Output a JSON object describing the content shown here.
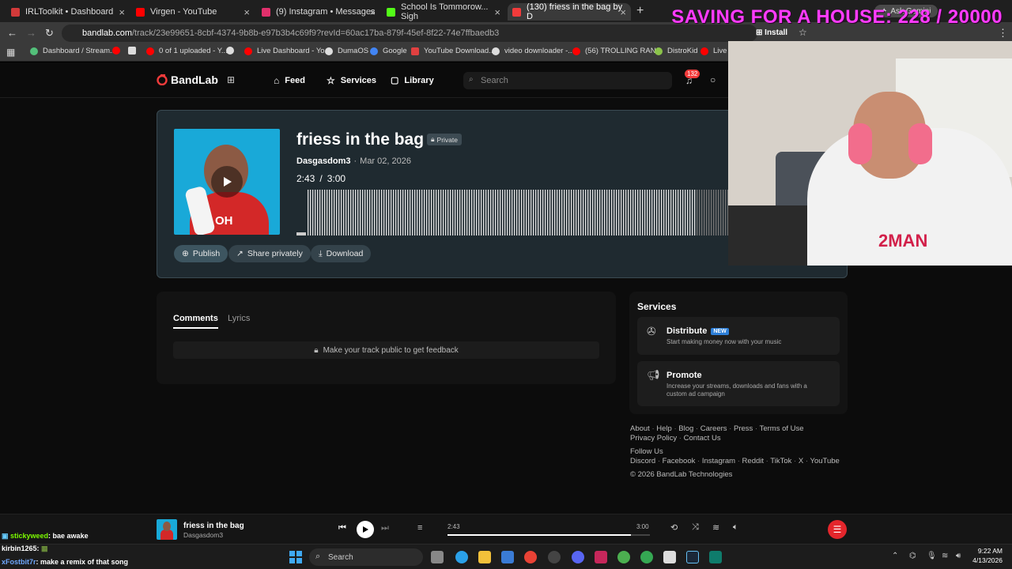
{
  "browser": {
    "tabs": [
      {
        "title": "IRLToolkit • Dashboard",
        "color": "#d23a3a"
      },
      {
        "title": "Virgen - YouTube",
        "color": "#ff0000"
      },
      {
        "title": "(9) Instagram • Messages",
        "color": "#e1306c"
      },
      {
        "title": "School Is Tommorow... Sigh",
        "color": "#53fc18"
      },
      {
        "title": "(130) friess in the bag by D",
        "color": "#f23b3b"
      }
    ],
    "url_host": "bandlab.com",
    "url_path": "/track/23e99651-8cbf-4374-9b8b-e97b3b4c69f9?revId=60ac17ba-879f-45ef-8f22-74e7ffbaedb3",
    "install_label": "Install",
    "ask_gemini": "Ask Gemini",
    "bookmarks": [
      {
        "label": "Dashboard / Stream...",
        "color": "#53c07a"
      },
      {
        "label": "",
        "color": "#ff0000"
      },
      {
        "label": "",
        "color": "#dddddd"
      },
      {
        "label": "0 of 1 uploaded - Y...",
        "color": "#ff0000"
      },
      {
        "label": "",
        "color": "#dddddd"
      },
      {
        "label": "Live Dashboard - Yo...",
        "color": "#ff0000"
      },
      {
        "label": "DumaOS",
        "color": "#dddddd"
      },
      {
        "label": "Google",
        "color": "#4285f4"
      },
      {
        "label": "YouTube Download...",
        "color": "#e04040"
      },
      {
        "label": "video downloader -...",
        "color": "#dddddd"
      },
      {
        "label": "(56) TROLLING RAN...",
        "color": "#ff0000"
      },
      {
        "label": "DistroKid",
        "color": "#8bc34a"
      },
      {
        "label": "Live D",
        "color": "#ff0000"
      }
    ]
  },
  "overlay": {
    "saving_text": "SAVING FOR A HOUSE: 228 / 20000"
  },
  "nav": {
    "brand": "BandLab",
    "feed": "Feed",
    "services": "Services",
    "library": "Library",
    "search_placeholder": "Search",
    "notif_count": "132"
  },
  "track": {
    "title": "friess in the bag",
    "privacy": "Private",
    "artist": "Dasgasdom3",
    "date": "Mar 02, 2026",
    "elapsed": "2:43",
    "duration": "3:00",
    "progress": 0.906,
    "cover_text": "OH",
    "actions": {
      "publish": "Publish",
      "share": "Share privately",
      "download": "Download"
    }
  },
  "comments": {
    "tab_comments": "Comments",
    "tab_lyrics": "Lyrics",
    "locked_msg": "Make your track public to get feedback"
  },
  "services_panel": {
    "title": "Services",
    "items": [
      {
        "name": "Distribute",
        "badge": "NEW",
        "desc": "Start making money now with your music"
      },
      {
        "name": "Promote",
        "badge": "",
        "desc": "Increase your streams, downloads and fans with a custom ad campaign"
      }
    ]
  },
  "footer": {
    "links1": [
      "About",
      "Help",
      "Blog",
      "Careers",
      "Press",
      "Terms of Use"
    ],
    "links2": [
      "Privacy Policy",
      "Contact Us"
    ],
    "follow": "Follow Us",
    "social": [
      "Discord",
      "Facebook",
      "Instagram",
      "Reddit",
      "TikTok",
      "X",
      "YouTube"
    ],
    "copyright": "© 2026 BandLab Technologies"
  },
  "player": {
    "title": "friess in the bag",
    "artist": "Dasgasdom3",
    "elapsed": "2:43",
    "duration": "3:00",
    "progress": 0.906
  },
  "chat": [
    {
      "user": "stickyweed",
      "msg": ": bae awake",
      "user_color": "#7CFC00"
    },
    {
      "user": "kirbin1265",
      "msg": ":",
      "user_color": "#ffffff"
    },
    {
      "user": "xFostbit7r",
      "msg": ": make a remix of that song",
      "user_color": "#6fa8ff"
    }
  ],
  "taskbar": {
    "search_placeholder": "Search",
    "time": "9:22 AM",
    "date": "4/13/2026"
  }
}
